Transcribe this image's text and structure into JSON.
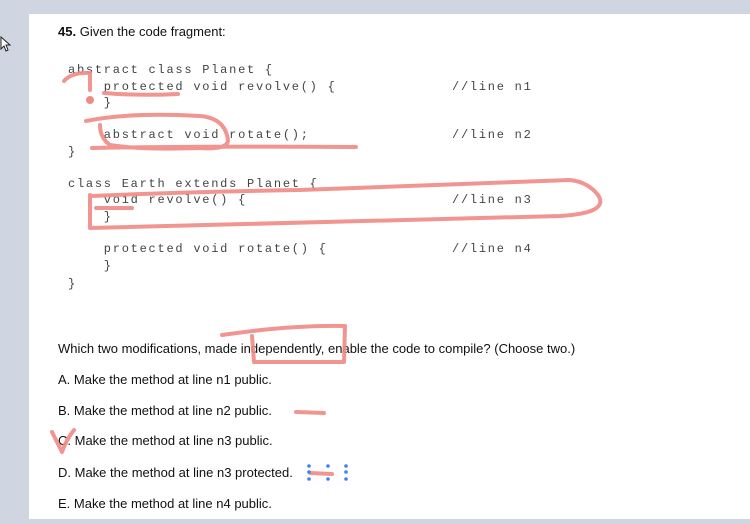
{
  "question": {
    "number": "45.",
    "title": "Given the code fragment:",
    "code_lines": [
      {
        "text": "abstract class Planet {",
        "comment": ""
      },
      {
        "text": "    protected void revolve() {",
        "comment": "//line n1"
      },
      {
        "text": "    }",
        "comment": ""
      },
      {
        "text": "    abstract void rotate();",
        "comment": "//line n2"
      },
      {
        "text": "}",
        "comment": ""
      },
      {
        "text": "class Earth extends Planet {",
        "comment": ""
      },
      {
        "text": "    void revolve() {",
        "comment": "//line n3"
      },
      {
        "text": "    }",
        "comment": ""
      },
      {
        "text": "    protected void rotate() {",
        "comment": "//line n4"
      },
      {
        "text": "    }",
        "comment": ""
      },
      {
        "text": "}",
        "comment": ""
      }
    ],
    "prompt": "Which two modifications, made independently, enable the code to compile? (Choose two.)",
    "options": [
      "A. Make the method at line n1 public.",
      "B. Make the method at line n2 public.",
      "C. Make the method at line n3 public.",
      "D. Make the method at line n3 protected.",
      "E. Make the method at line n4 public."
    ]
  },
  "colors": {
    "annotation": "#f08a86",
    "selection_handles": "#3b82f6",
    "background": "#cfd5e1"
  },
  "icons": [
    "mouse-pointer-icon"
  ]
}
